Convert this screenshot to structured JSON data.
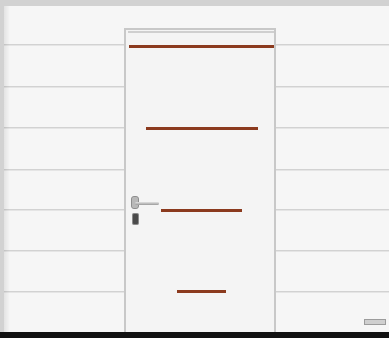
{
  "garage_door": {
    "colors": {
      "panel": "#f6f6f6",
      "accent": "#8b3a1e",
      "frame": "#c8c8c8",
      "base": "#111111"
    },
    "brand_plate": {
      "icon": "brand-plate-icon"
    },
    "wicket_door": {
      "handle_icon": "door-handle-icon",
      "lock_icon": "lock-cylinder-icon"
    }
  }
}
